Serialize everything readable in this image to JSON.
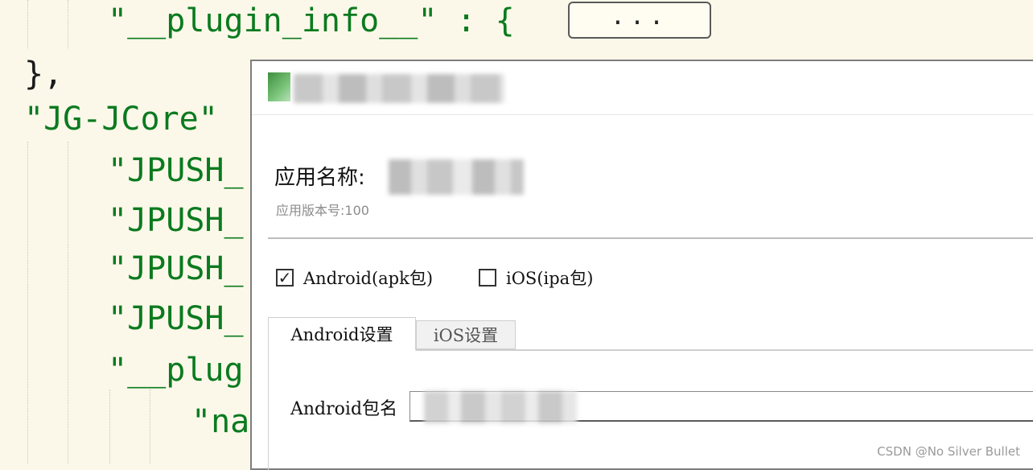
{
  "editor": {
    "lines": [
      "\"__plugin_info__\" : {",
      "},",
      "\"JG-JCore\"",
      "\"JPUSH_",
      "\"JPUSH_",
      "\"JPUSH_",
      "\"JPUSH_",
      "\"__plug",
      "\"na"
    ],
    "fold_placeholder": "..."
  },
  "dialog": {
    "app_name_label": "应用名称:",
    "version_label": "应用版本号:100",
    "platforms": [
      {
        "label": "Android(apk包)",
        "checked": true
      },
      {
        "label": "iOS(ipa包)",
        "checked": false
      }
    ],
    "tabs": [
      {
        "label": "Android设置",
        "active": true
      },
      {
        "label": "iOS设置",
        "active": false
      }
    ],
    "android_package_label": "Android包名"
  },
  "watermark": "CSDN @No Silver Bullet",
  "icons": {
    "app": "app-icon",
    "checkmark": "checkmark-icon"
  },
  "colors": {
    "editor_bg": "#fbf8e9",
    "string": "#0b7a1f",
    "dialog_bg": "#ffffff"
  }
}
